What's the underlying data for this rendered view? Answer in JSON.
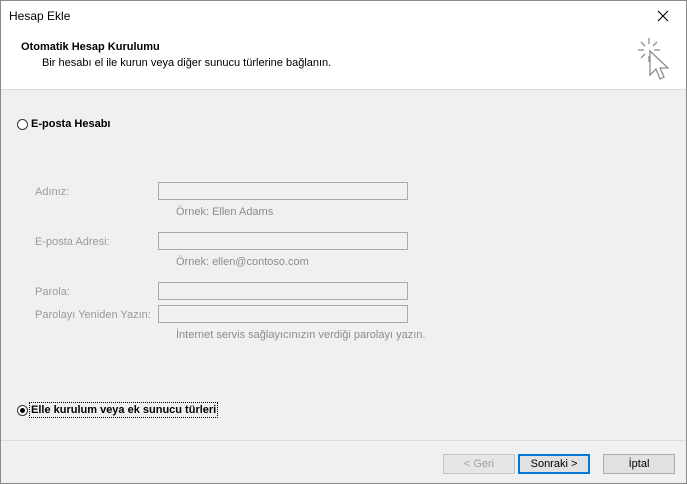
{
  "window": {
    "title": "Hesap Ekle"
  },
  "header": {
    "title": "Otomatik Hesap Kurulumu",
    "subtitle": "Bir hesabı el ile kurun veya diğer sunucu türlerine bağlanın."
  },
  "options": {
    "email_account": {
      "label": "E-posta Hesabı",
      "checked": false
    },
    "manual_setup": {
      "label": "Elle kurulum veya ek sunucu türleri",
      "checked": true
    }
  },
  "form": {
    "name": {
      "label": "Adınız:",
      "value": "",
      "hint": "Örnek: Ellen Adams"
    },
    "email": {
      "label": "E-posta Adresi:",
      "value": "",
      "hint": "Örnek: ellen@contoso.com"
    },
    "password": {
      "label": "Parola:",
      "value": ""
    },
    "password_confirm": {
      "label": "Parolayı Yeniden Yazın:",
      "value": "",
      "hint": "İnternet servis sağlayıcınızın verdiği parolayı yazın."
    }
  },
  "buttons": {
    "back": "< Geri",
    "next": "Sonraki >",
    "cancel": "İptal"
  },
  "colors": {
    "focus_border": "#0078d7",
    "disabled_text": "#9a9a9a",
    "panel_bg": "#f0f0f0"
  }
}
